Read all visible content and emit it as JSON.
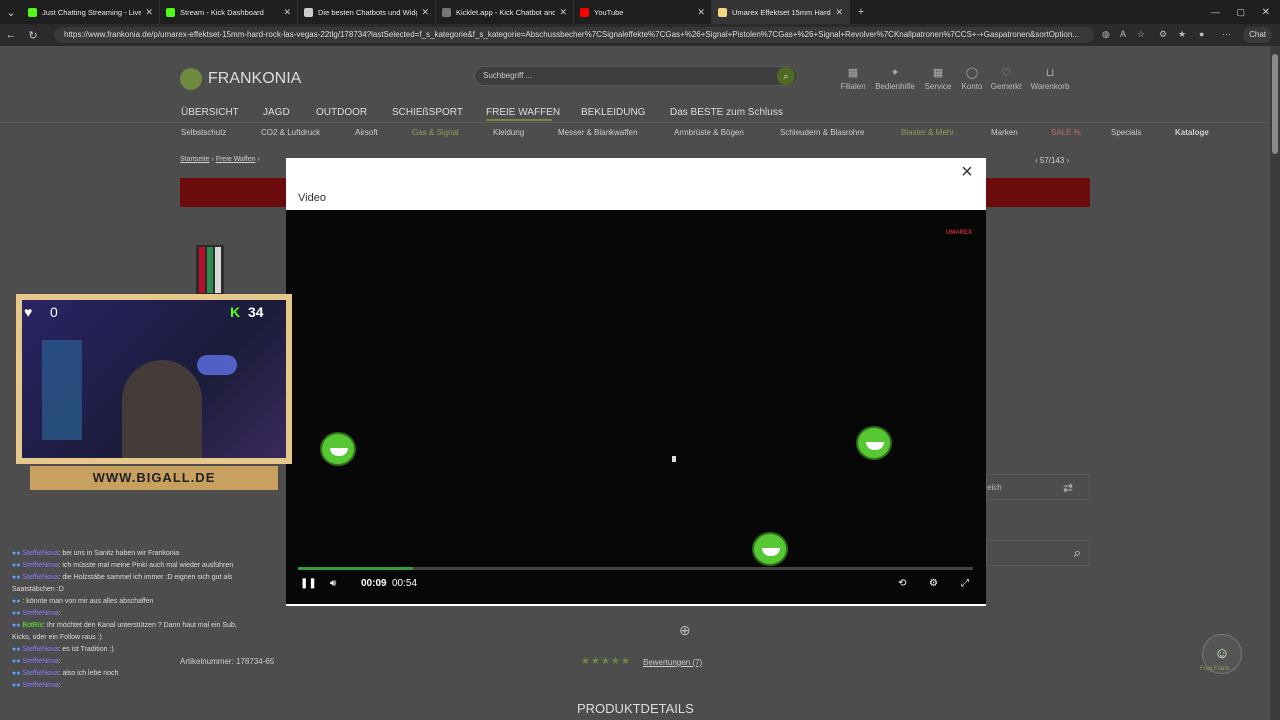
{
  "tabs": [
    {
      "title": "Just Chatting Streaming - Live Stre",
      "color": "#53fc18"
    },
    {
      "title": "Stream - Kick Dashboard",
      "color": "#53fc18"
    },
    {
      "title": "Die besten Chatbots und Widgets",
      "color": "#cccccc"
    },
    {
      "title": "Kicklet.app - Kick Chatbot and Ov",
      "color": "#777777"
    },
    {
      "title": "YouTube",
      "color": "#ff0000"
    },
    {
      "title": "Umarex Effektset 15mm Hard",
      "color": "#f5d680"
    }
  ],
  "address_url": "https://www.frankonia.de/p/umarex-effektset-15mm-hard-rock-las-vegas-22tlg/178734?lastSelected=f_s_kategorie&f_s_kategorie=Abschussbecher%7CSignaleffekte%7CGas+%26+Signal+Pistolen%7CGas+%26+Signal+Revolver%7CKnallpatronen%7CCS+-+Gaspatronen&sortOption...",
  "chat_button": "Chat",
  "site": {
    "logo": "FRANKONIA",
    "search_placeholder": "Suchbegriff ...",
    "tools": [
      "Filialen",
      "Bedienhilfe",
      "Service",
      "Konto",
      "Gemerkt",
      "Warenkorb"
    ],
    "nav_main": [
      "ÜBERSICHT",
      "JAGD",
      "OUTDOOR",
      "SCHIEßSPORT",
      "FREIE WAFFEN",
      "BEKLEIDUNG",
      "Das BESTE zum Schluss"
    ],
    "nav_sub": [
      "Selbstschutz",
      "CO2 & Luftdruck",
      "Airsoft",
      "Gas & Signal",
      "Kleidung",
      "Messer & Blankwaffen",
      "Armbrüste & Bögen",
      "Schleudern & Blasrohre",
      "Blaster & Mehr",
      "Marken",
      "SALE %",
      "Specials",
      "Kataloge"
    ],
    "breadcrumb_home": "Startseite",
    "breadcrumb_section": "Freie Waffen",
    "pager": "57/143",
    "compare_text": "eich",
    "artnr_label": "Artikelnummer:",
    "artnr_value": "178734-65",
    "reviews": "Bewertungen (7)",
    "rating": 5,
    "product_heading": "PRODUKTDETAILS",
    "frog_label": "Frag Frank ..."
  },
  "modal": {
    "title": "Video",
    "brand": "UMAREX",
    "current_time": "00:09",
    "duration": "00:54",
    "progress": 0.17
  },
  "stream": {
    "viewers_left": "0",
    "viewers_right": "34",
    "banner": "WWW.BIGALL.DE"
  },
  "chat": [
    {
      "user": "SteffieNova",
      "msg": ": bei uns in Sanitz haben wir Frankonia"
    },
    {
      "user": "SteffieNova",
      "msg": ": ich müsste mal meine Pinki auch mal wieder ausführen"
    },
    {
      "user": "SteffieNova",
      "msg": ": die Holzstäbe sammel ich immer :D eignen sich gut als Saatstäbchen :D"
    },
    {
      "user": "",
      "msg": ": könnte man von mir aus alles abschaffen"
    },
    {
      "user": "SteffieNova",
      "msg": ":"
    },
    {
      "user": "BotRix",
      "msg": ": Ihr möchtet den Kanal unterstützen ? Dann haut mal ein Sub, Kicks, oder ein Follow raus :)",
      "bot": true
    },
    {
      "user": "SteffieNova",
      "msg": ": es ist Tradition :)"
    },
    {
      "user": "SteffieNova",
      "msg": ":"
    },
    {
      "user": "SteffieNova",
      "msg": ": also ich lebe noch"
    },
    {
      "user": "SteffieNova",
      "msg": ":"
    }
  ]
}
